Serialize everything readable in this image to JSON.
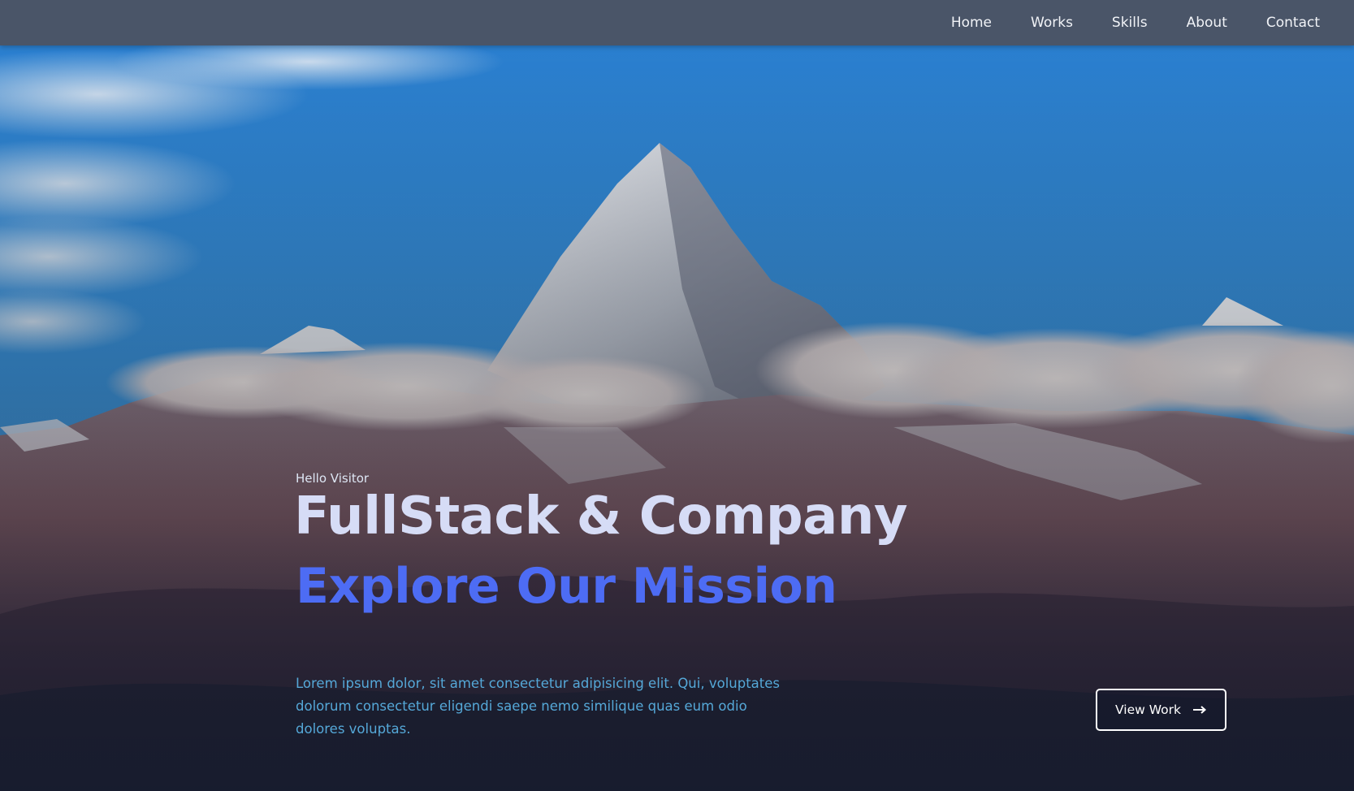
{
  "nav": {
    "items": [
      {
        "label": "Home"
      },
      {
        "label": "Works"
      },
      {
        "label": "Skills"
      },
      {
        "label": "About"
      },
      {
        "label": "Contact"
      }
    ]
  },
  "hero": {
    "background_image": "snow-capped-mountain-peak-icon",
    "greeting": "Hello Visitor",
    "title": "FullStack & Company",
    "subtitle": "Explore Our Mission",
    "description": "Lorem ipsum dolor, sit amet consectetur adipisicing elit. Qui, voluptates dolorum consectetur eligendi saepe nemo similique quas eum odio dolores voluptas.",
    "cta": {
      "label": "View Work",
      "icon": "arrow-right-icon"
    }
  },
  "colors": {
    "navbar_bg": "#4a5568",
    "title": "#d6dcf6",
    "subtitle_accent": "#4d6cf4",
    "description": "#55a8d8",
    "sky": "#2f87d4"
  }
}
